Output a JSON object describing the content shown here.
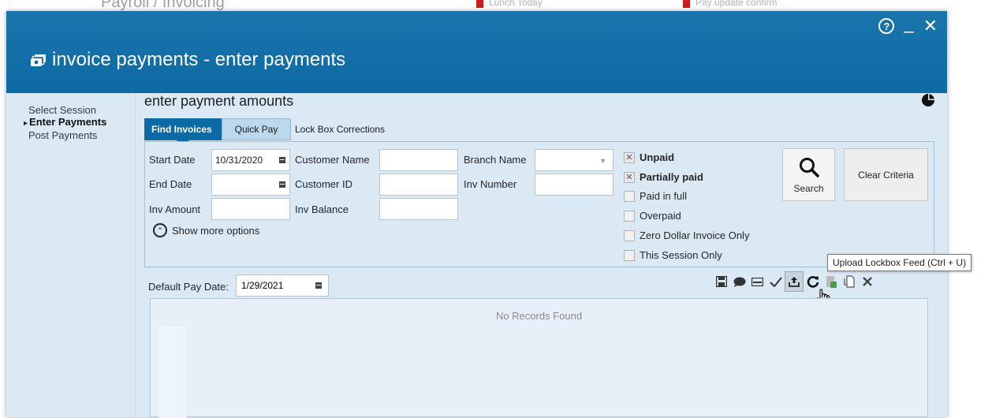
{
  "window": {
    "title": "invoice payments - enter payments",
    "title_icon": "invoice-cards-icon",
    "controls": {
      "help": "?",
      "minimize": "_",
      "close": "✕"
    }
  },
  "background": {
    "app_title": "Payroll / Invoicing",
    "alert1": "Lunch Today",
    "alert2": "Pay update confirm"
  },
  "nav": {
    "items": [
      {
        "label": "Select Session",
        "active": false
      },
      {
        "label": "Enter Payments",
        "active": true
      },
      {
        "label": "Post Payments",
        "active": false
      }
    ]
  },
  "main": {
    "heading": "enter payment amounts",
    "tabs": [
      {
        "label": "Find Invoices",
        "active": true
      },
      {
        "label": "Quick Pay",
        "active": false
      },
      {
        "label": "Lock Box Corrections",
        "active": false
      }
    ],
    "criteria": {
      "start_date_label": "Start Date",
      "start_date_value": "10/31/2020",
      "end_date_label": "End Date",
      "end_date_value": "",
      "inv_amount_label": "Inv Amount",
      "inv_amount_value": "",
      "customer_name_label": "Customer Name",
      "customer_name_value": "",
      "customer_id_label": "Customer ID",
      "customer_id_value": "",
      "inv_balance_label": "Inv Balance",
      "inv_balance_value": "",
      "branch_name_label": "Branch Name",
      "branch_name_value": "",
      "inv_number_label": "Inv Number",
      "inv_number_value": "",
      "show_more": "Show more options",
      "checkboxes": [
        {
          "label": "Unpaid",
          "checked": true
        },
        {
          "label": "Partially paid",
          "checked": true
        },
        {
          "label": "Paid in full",
          "checked": false
        },
        {
          "label": "Overpaid",
          "checked": false
        },
        {
          "label": "Zero Dollar Invoice Only",
          "checked": false
        },
        {
          "label": "This Session Only",
          "checked": false
        }
      ],
      "search_label": "Search",
      "clear_label": "Clear Criteria"
    },
    "default_pay_label": "Default Pay Date:",
    "default_pay_value": "1/29/2021",
    "toolbar": [
      {
        "icon": "save-icon"
      },
      {
        "icon": "comment-icon"
      },
      {
        "icon": "card-icon"
      },
      {
        "icon": "checkmark-icon"
      },
      {
        "icon": "upload-icon",
        "highlighted": true
      },
      {
        "icon": "refresh-icon"
      },
      {
        "icon": "export-icon"
      },
      {
        "icon": "copy-icon"
      },
      {
        "icon": "delete-icon"
      }
    ],
    "tooltip": "Upload Lockbox Feed (Ctrl + U)",
    "grid_empty_text": "No Records Found"
  },
  "colors": {
    "titlebar": "#0e6aa4",
    "panel": "#dbe9f5",
    "tab_active": "#0e6aa4"
  }
}
